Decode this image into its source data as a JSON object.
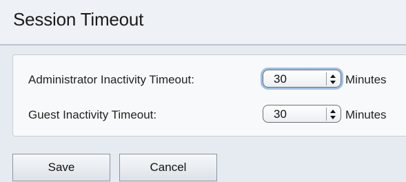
{
  "page": {
    "title": "Session Timeout"
  },
  "fields": {
    "admin": {
      "label": "Administrator Inactivity Timeout:",
      "value": "30",
      "unit": "Minutes"
    },
    "guest": {
      "label": "Guest Inactivity Timeout:",
      "value": "30",
      "unit": "Minutes"
    }
  },
  "buttons": {
    "save_label": "Save",
    "cancel_label": "Cancel"
  },
  "icons": {
    "select_stepper": "up-down-arrows-icon"
  },
  "colors": {
    "background": "#e6ebf1",
    "panel": "#f8f9fa",
    "focus_ring": "#9cbfe6"
  }
}
